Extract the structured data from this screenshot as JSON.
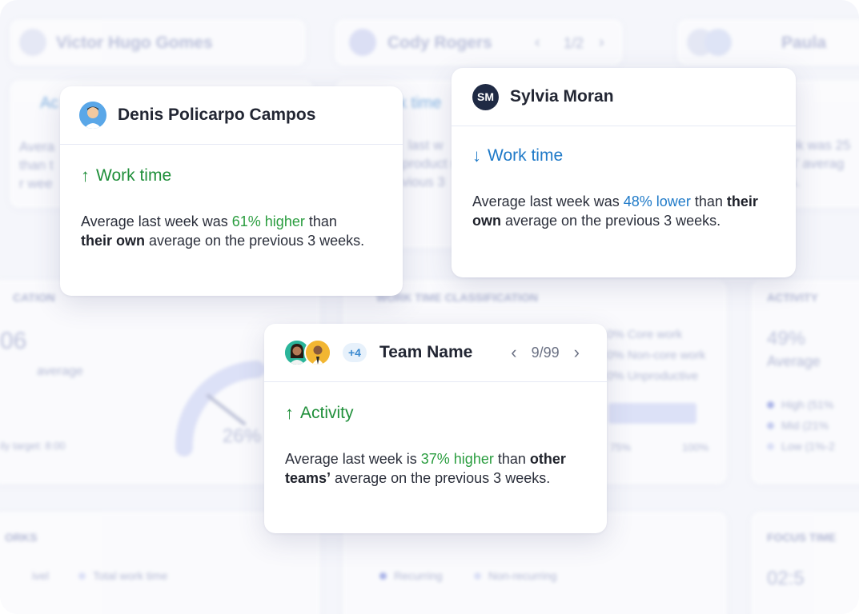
{
  "background": {
    "header_names": [
      "Victor Hugo Gomes",
      "Cody Rogers",
      "Paula"
    ],
    "pager": "1/2",
    "left_partial_lines": [
      "Ac",
      "Avera",
      "than t",
      "r wee"
    ],
    "mid_partial_lines": [
      "k time",
      "last w",
      "product n",
      "vious 3"
    ],
    "right_partial_lines": [
      "ek was 25",
      "s' averag",
      "s."
    ],
    "section_titles": {
      "classification": "CATION",
      "work_time_classification": "WORK TIME CLASSIFICATION",
      "activity": "ACTIVITY",
      "bottom_left": "ORKS",
      "focus_time": "FOCUS TIME"
    },
    "left_value": "06",
    "left_sub": "average",
    "left_target": "ily target: 8:00",
    "gauge_value": "26%",
    "classification_legend": [
      "0% Core work",
      "0% Non-core work",
      "0% Unproductive"
    ],
    "axis_labels": [
      "75%",
      "100%"
    ],
    "activity_value": "49%",
    "activity_sub": "Average",
    "activity_legend": [
      "High (51%",
      "Mid (21%",
      "Low (1%-2"
    ],
    "bottom_legend_left": [
      "ivel",
      "Total work time"
    ],
    "bottom_legend_mid": [
      "Recurring",
      "Non-recurring"
    ],
    "focus_value": "02:5"
  },
  "card_denis": {
    "name": "Denis Policarpo Campos",
    "metric_label": "Work time",
    "metric_arrow": "↑",
    "text_before": "Average last week was ",
    "highlight": "61% higher",
    "text_mid": " than",
    "bold": "their own",
    "text_after": " average on the previous 3 weeks."
  },
  "card_sylvia": {
    "initials": "SM",
    "name": "Sylvia Moran",
    "metric_label": "Work time",
    "metric_arrow": "↓",
    "text_before": "Average last week was ",
    "highlight": "48% lower",
    "text_mid": " than ",
    "bold1": "their",
    "bold2": "own",
    "text_after": " average on the previous 3 weeks."
  },
  "card_team": {
    "extra_count": "+4",
    "name": "Team Name",
    "pager": "9/99",
    "metric_label": "Activity",
    "metric_arrow": "↑",
    "text_before": "Average last week is ",
    "highlight": "37% higher",
    "text_mid": " than ",
    "bold1": "other",
    "bold2": "teams’",
    "text_after": " average on the previous 3 weeks."
  },
  "colors": {
    "positive": "#1f8f3a",
    "negative": "#1f7ac8",
    "sm_avatar": "#1f2a44"
  }
}
